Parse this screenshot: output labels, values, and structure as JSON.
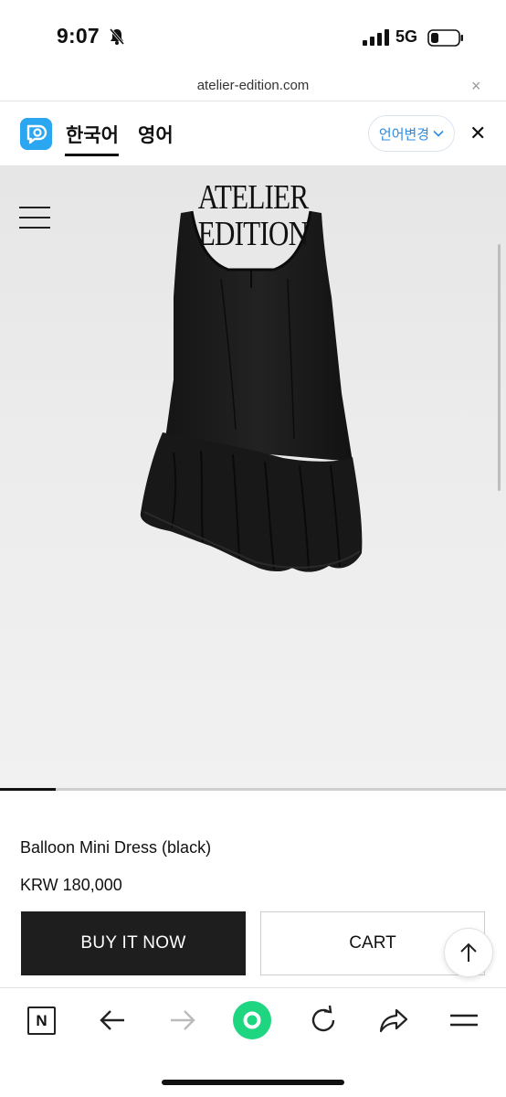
{
  "status_bar": {
    "time": "9:07",
    "network": "5G"
  },
  "browser": {
    "url": "atelier-edition.com",
    "close_symbol": "×"
  },
  "translate_bar": {
    "languages": [
      "한국어",
      "영어"
    ],
    "change_label": "언어변경",
    "close_symbol": "✕"
  },
  "hero": {
    "logo_line1": "ATELIER",
    "logo_line2": "EDITION",
    "gallery_progress": 0.11
  },
  "product": {
    "name": "Balloon Mini Dress (black)",
    "price": "KRW 180,000",
    "buy_label": "BUY IT NOW",
    "cart_label": "CART"
  },
  "toolbar": {
    "n_label": "N",
    "icons": [
      "n-app-icon",
      "back-arrow-icon",
      "forward-arrow-icon",
      "home-dot-icon",
      "refresh-icon",
      "share-icon",
      "menu-icon"
    ]
  },
  "colors": {
    "accent_green": "#1ed680",
    "link_blue": "#2f8be0",
    "papago_blue": "#2aa7f0",
    "buy_bg": "#1e1e1e"
  }
}
